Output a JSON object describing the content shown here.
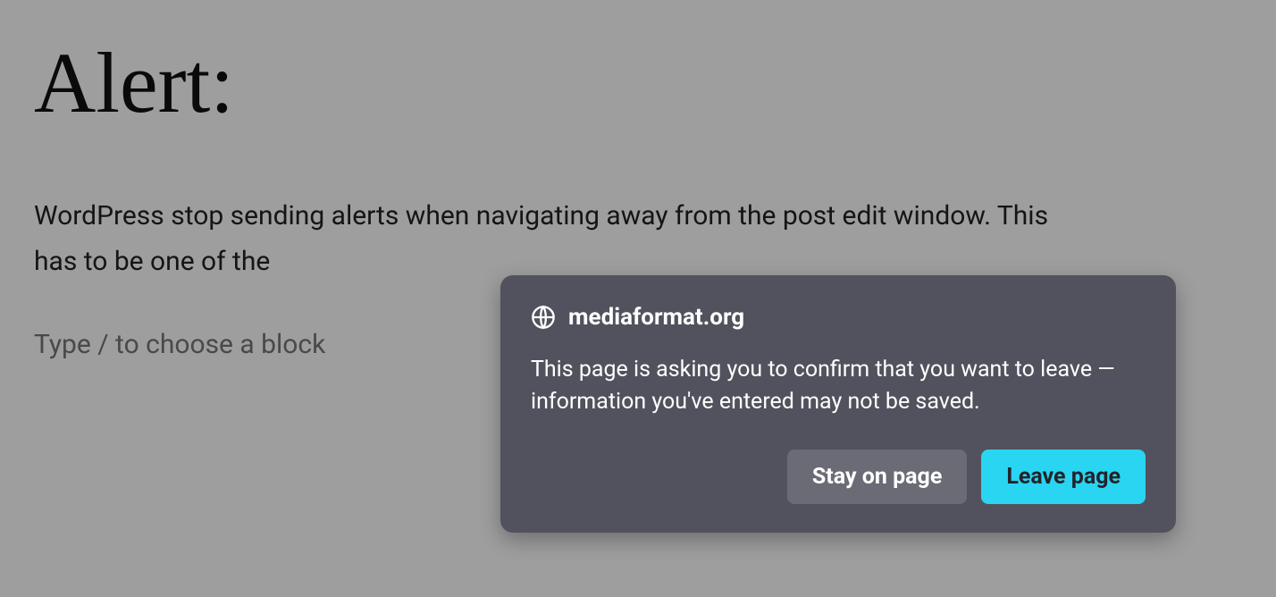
{
  "editor": {
    "title": "Alert:",
    "body": "WordPress stop sending alerts when navigating away from the post edit window. This has to be one of the",
    "block_placeholder": "Type / to choose a block"
  },
  "dialog": {
    "site": "mediaformat.org",
    "message": "This page is asking you to confirm that you want to leave — information you've entered may not be saved.",
    "stay_label": "Stay on page",
    "leave_label": "Leave page"
  }
}
